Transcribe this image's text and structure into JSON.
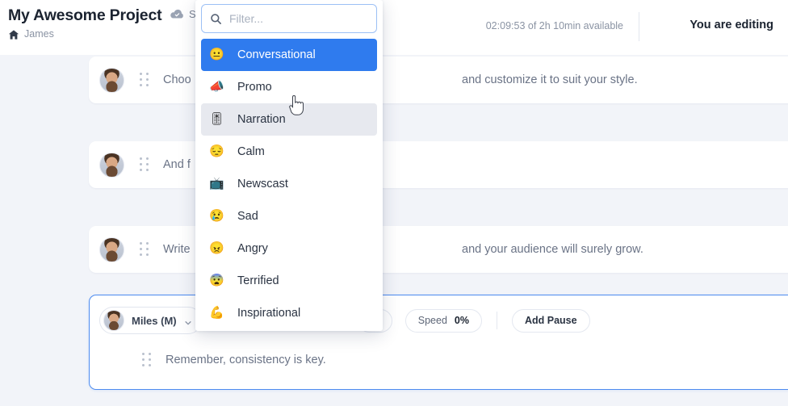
{
  "header": {
    "project_title": "My Awesome Project",
    "home_icon": "home-icon",
    "breadcrumb_name": "James",
    "cloud_icon": "cloud-check-icon",
    "save_label": "S",
    "time_info": "02:09:53 of 2h 10min available",
    "editing_state": "You are editing"
  },
  "blocks": [
    {
      "text": "Choo",
      "text_tail": "and customize it to suit your style.",
      "drag_icon": "drag-handle-icon",
      "avatar": "avatar"
    },
    {
      "text": "And f",
      "text_tail": "",
      "drag_icon": "drag-handle-icon",
      "avatar": "avatar"
    },
    {
      "text": "Write",
      "text_tail": "and your audience will surely grow.",
      "drag_icon": "drag-handle-icon",
      "avatar": "avatar"
    }
  ],
  "active_block": {
    "speaker_name": "Miles (M)",
    "chevron_icon": "chevron-down-icon",
    "pitch_value": "%",
    "speed_label": "Speed",
    "speed_value": "0%",
    "add_pause_label": "Add Pause",
    "text": "Remember, consistency is key."
  },
  "dropdown": {
    "search_icon": "search-icon",
    "filter_placeholder": "Filter...",
    "filter_value": "",
    "selected_color": "#2f7bee",
    "hover_color": "#e7e9ef",
    "options": [
      {
        "emoji": "😐",
        "label": "Conversational",
        "state": "selected"
      },
      {
        "emoji": "📣",
        "label": "Promo",
        "state": "normal"
      },
      {
        "emoji": "🎚",
        "label": "Narration",
        "state": "hover"
      },
      {
        "emoji": "😔",
        "label": "Calm",
        "state": "normal"
      },
      {
        "emoji": "📺",
        "label": "Newscast",
        "state": "normal"
      },
      {
        "emoji": "😢",
        "label": "Sad",
        "state": "normal"
      },
      {
        "emoji": "😠",
        "label": "Angry",
        "state": "normal"
      },
      {
        "emoji": "😨",
        "label": "Terrified",
        "state": "normal"
      },
      {
        "emoji": "💪",
        "label": "Inspirational",
        "state": "normal"
      }
    ]
  }
}
